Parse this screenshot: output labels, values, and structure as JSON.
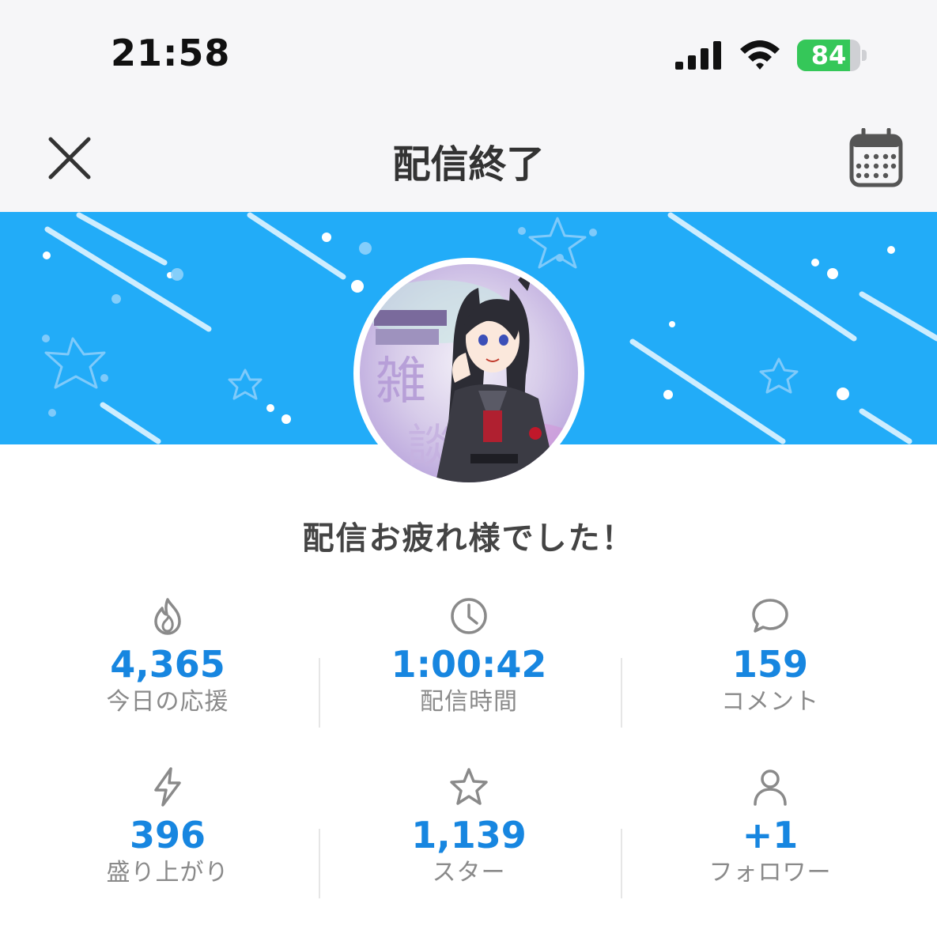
{
  "status_bar": {
    "time": "21:58",
    "battery": "84",
    "battery_level": 0.84
  },
  "nav": {
    "title": "配信終了"
  },
  "greeting": "配信お疲れ様でした！",
  "colors": {
    "accent": "#1786e0",
    "banner": "#22acf8",
    "battery": "#35c759"
  },
  "stats": [
    {
      "icon": "flame-icon",
      "value": "4,365",
      "label": "今日の応援"
    },
    {
      "icon": "clock-icon",
      "value": "1:00:42",
      "label": "配信時間"
    },
    {
      "icon": "comment-bubble-icon",
      "value": "159",
      "label": "コメント"
    },
    {
      "icon": "lightning-icon",
      "value": "396",
      "label": "盛り上がり"
    },
    {
      "icon": "star-icon",
      "value": "1,139",
      "label": "スター"
    },
    {
      "icon": "person-icon",
      "value": "+1",
      "label": "フォロワー"
    }
  ]
}
